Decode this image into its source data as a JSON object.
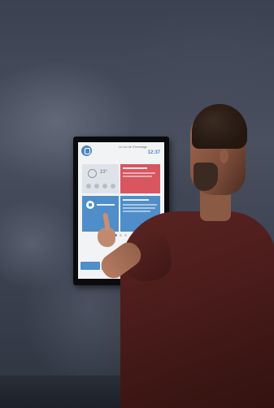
{
  "scene": {
    "description_tags": [
      "man",
      "touchscreen-kiosk",
      "dark-textured-wall"
    ]
  },
  "kiosk": {
    "header_title": "Le Lez de l'Hermitage",
    "clock": "12:37",
    "weather": {
      "temperature": "23°"
    },
    "colors": {
      "accent_blue": "#4f8ec9",
      "accent_red": "#d9555f",
      "frame": "#0b0b0d"
    },
    "icons": [
      "logo-icon",
      "sun-icon",
      "phone-icon"
    ]
  }
}
